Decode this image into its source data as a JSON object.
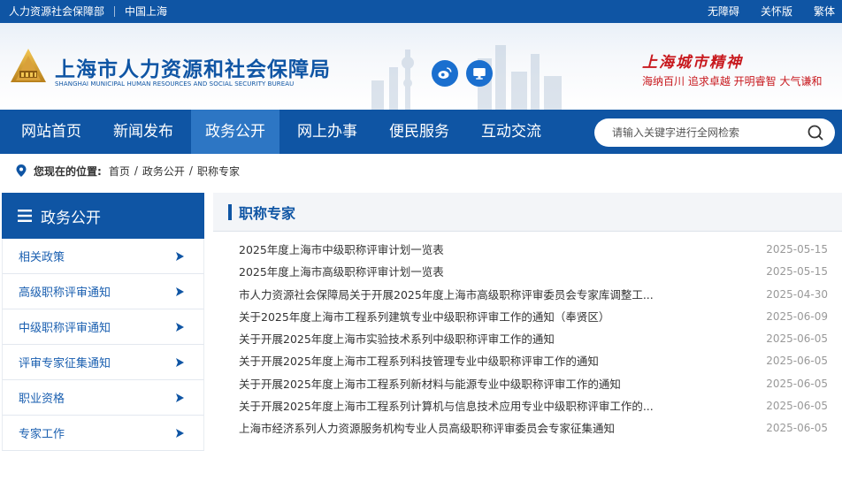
{
  "topbar": {
    "ministry": "人力资源社会保障部",
    "china_shanghai": "中国上海",
    "accessibility": "无障碍",
    "care_mode": "关怀版",
    "traditional": "繁体"
  },
  "header": {
    "title": "上海市人力资源和社会保障局",
    "subtitle": "SHANGHAI MUNICIPAL HUMAN RESOURCES AND SOCIAL SECURITY BUREAU",
    "spirit_title": "上海城市精神",
    "spirit_text": "海纳百川 追求卓越 开明睿智 大气谦和",
    "weibo_icon": "weibo-icon",
    "app_icon": "monitor-icon"
  },
  "nav": {
    "items": [
      {
        "label": "网站首页"
      },
      {
        "label": "新闻发布"
      },
      {
        "label": "政务公开"
      },
      {
        "label": "网上办事"
      },
      {
        "label": "便民服务"
      },
      {
        "label": "互动交流"
      }
    ],
    "active_index": 2,
    "search_placeholder": "请输入关键字进行全网检索"
  },
  "breadcrumb": {
    "label": "您现在的位置:",
    "items": [
      "首页",
      "政务公开",
      "职称专家"
    ]
  },
  "sidebar": {
    "title": "政务公开",
    "items": [
      {
        "label": "相关政策"
      },
      {
        "label": "高级职称评审通知"
      },
      {
        "label": "中级职称评审通知"
      },
      {
        "label": "评审专家征集通知"
      },
      {
        "label": "职业资格"
      },
      {
        "label": "专家工作"
      }
    ]
  },
  "main": {
    "title": "职称专家",
    "news": [
      {
        "title": "2025年度上海市中级职称评审计划一览表",
        "date": "2025-05-15"
      },
      {
        "title": "2025年度上海市高级职称评审计划一览表",
        "date": "2025-05-15"
      },
      {
        "title": "市人力资源社会保障局关于开展2025年度上海市高级职称评审委员会专家库调整工...",
        "date": "2025-04-30"
      },
      {
        "title": "关于2025年度上海市工程系列建筑专业中级职称评审工作的通知（奉贤区）",
        "date": "2025-06-09"
      },
      {
        "title": "关于开展2025年度上海市实验技术系列中级职称评审工作的通知",
        "date": "2025-06-05"
      },
      {
        "title": "关于开展2025年度上海市工程系列科技管理专业中级职称评审工作的通知",
        "date": "2025-06-05"
      },
      {
        "title": "关于开展2025年度上海市工程系列新材料与能源专业中级职称评审工作的通知",
        "date": "2025-06-05"
      },
      {
        "title": "关于开展2025年度上海市工程系列计算机与信息技术应用专业中级职称评审工作的...",
        "date": "2025-06-05"
      },
      {
        "title": "上海市经济系列人力资源服务机构专业人员高级职称评审委员会专家征集通知",
        "date": "2025-06-05"
      }
    ]
  },
  "colors": {
    "primary": "#0f55a4",
    "active_nav": "#2d76c4",
    "spirit_red": "#c8191e",
    "date_gray": "#999999"
  }
}
